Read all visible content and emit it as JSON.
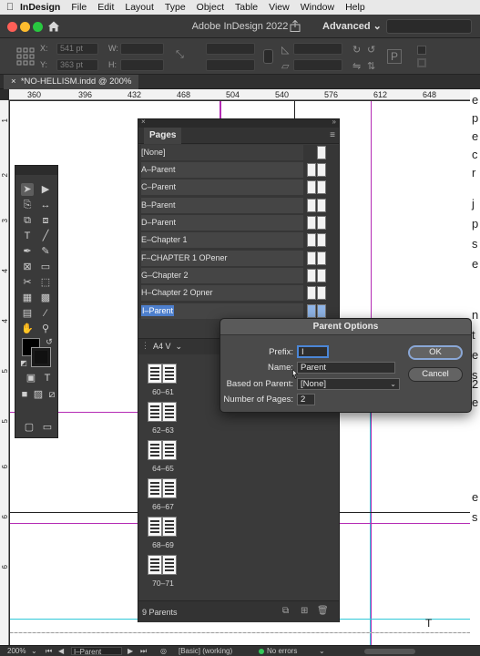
{
  "menubar": {
    "app_name": "InDesign",
    "items": [
      "File",
      "Edit",
      "Layout",
      "Type",
      "Object",
      "Table",
      "View",
      "Window",
      "Help"
    ]
  },
  "titlebar": {
    "title": "Adobe InDesign 2022",
    "workspace": "Advanced ⌄"
  },
  "controlbar": {
    "x_label": "X:",
    "x_value": "541 pt",
    "y_label": "Y:",
    "y_value": "363 pt",
    "w_label": "W:",
    "h_label": "H:"
  },
  "document": {
    "tab_label": "*NO-HELLISM.indd @ 200%",
    "ruler_h": [
      "360",
      "396",
      "432",
      "468",
      "504",
      "540",
      "576",
      "612",
      "648"
    ],
    "ruler_v": [
      "1",
      "2",
      "3",
      "4",
      "4",
      "5",
      "5",
      "6",
      "6",
      "6"
    ],
    "side_letters": [
      "e",
      "p",
      "e",
      "c",
      "r",
      "j",
      "p",
      "s",
      "e",
      "n",
      "t",
      "e",
      "s",
      "2",
      "e",
      "e",
      "s"
    ]
  },
  "pages_panel": {
    "title": "Pages",
    "parents": [
      {
        "label": "[None]"
      },
      {
        "label": "A–Parent"
      },
      {
        "label": "C–Parent"
      },
      {
        "label": "B–Parent"
      },
      {
        "label": "D–Parent"
      },
      {
        "label": "E–Chapter 1"
      },
      {
        "label": "F–CHAPTER 1 OPener"
      },
      {
        "label": "G–Chapter 2"
      },
      {
        "label": "H–Chapter 2 Opner"
      },
      {
        "label": "I–Parent"
      }
    ],
    "page_size": "A4 V",
    "spreads": [
      "60–61",
      "62–63",
      "64–65",
      "66–67",
      "68–69",
      "70–71"
    ],
    "footer_count": "9 Parents"
  },
  "dialog": {
    "title": "Parent Options",
    "prefix_label": "Prefix:",
    "prefix_value": "I",
    "name_label": "Name:",
    "name_value": "Parent",
    "based_on_label": "Based on Parent:",
    "based_on_value": "[None]",
    "num_pages_label": "Number of Pages:",
    "num_pages_value": "2",
    "ok_label": "OK",
    "cancel_label": "Cancel"
  },
  "statusbar": {
    "zoom": "200%",
    "page": "I–Parent",
    "preflight_profile": "[Basic] (working)",
    "errors": "No errors"
  },
  "colors": {
    "accent": "#4d7fcd",
    "guide_magenta": "#b42bb4",
    "guide_cyan": "#30c8d8"
  }
}
